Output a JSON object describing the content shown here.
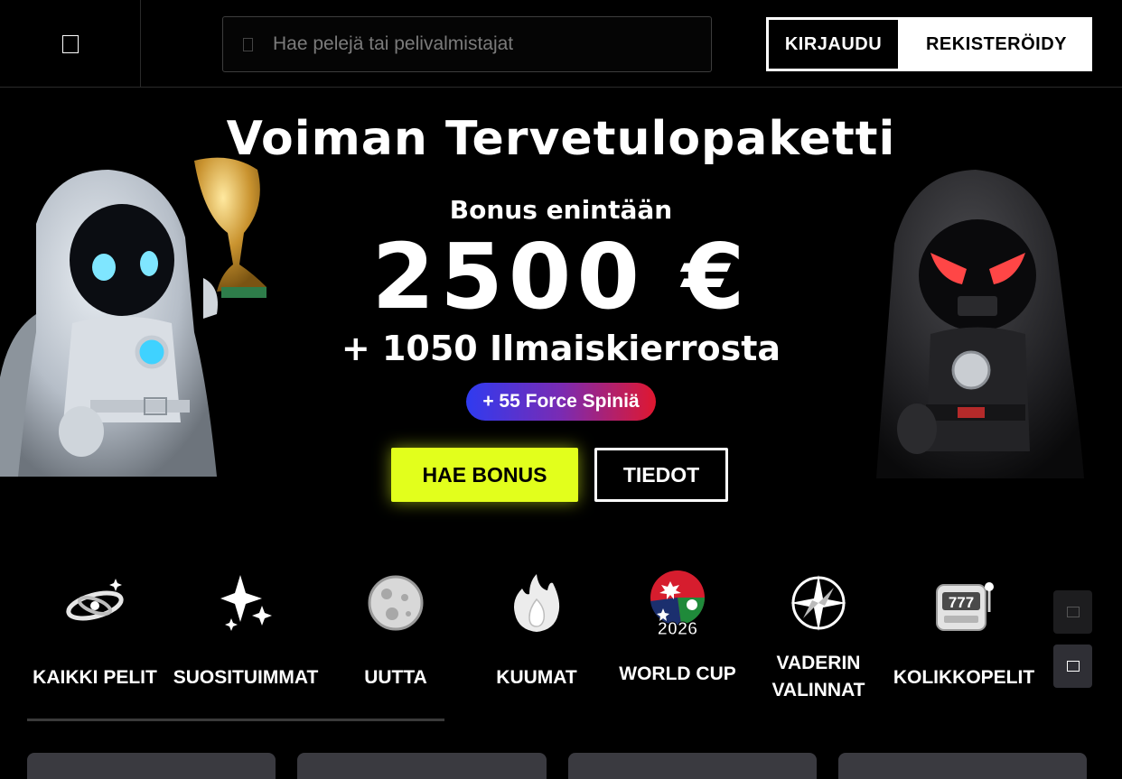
{
  "header": {
    "search_placeholder": "Hae pelejä tai pelivalmistajat",
    "login_label": "KIRJAUDU",
    "register_label": "REKISTERÖIDY"
  },
  "hero": {
    "title": "Voiman Tervetulopaketti",
    "bonus_prefix": "Bonus enintään",
    "amount": "2500 €",
    "free_spins": "+ 1050 Ilmaiskierrosta",
    "force_spins": "+ 55 Force Spiniä",
    "cta_primary": "HAE BONUS",
    "cta_secondary": "TIEDOT"
  },
  "categories": [
    {
      "label": "KAIKKI PELIT",
      "icon": "galaxy-icon"
    },
    {
      "label": "SUOSITUIMMAT",
      "icon": "sparkles-icon"
    },
    {
      "label": "UUTTA",
      "icon": "moon-icon"
    },
    {
      "label": "KUUMAT",
      "icon": "flame-icon"
    },
    {
      "label": "WORLD CUP",
      "icon": "world-cup-2026-icon",
      "badge": "2026"
    },
    {
      "label": "VADERIN VALINNAT",
      "icon": "compass-star-icon"
    },
    {
      "label": "KOLIKKOPELIT",
      "icon": "slot-machine-icon",
      "badge": "777"
    }
  ],
  "colors": {
    "accent": "#e2ff1c",
    "background": "#000000",
    "pill_gradient_start": "#2f3bf0",
    "pill_gradient_end": "#e0172f"
  }
}
